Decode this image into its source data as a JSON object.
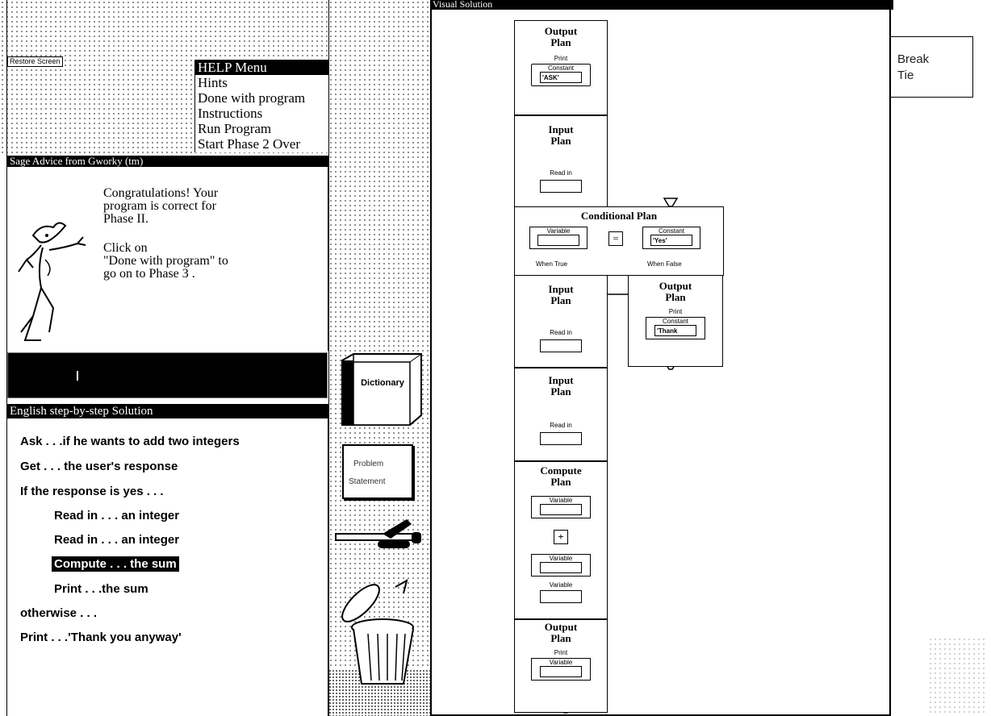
{
  "restore_screen": "Restore Screen",
  "help_menu": {
    "title": "HELP Menu",
    "items": [
      "Hints",
      "Done with program",
      "Instructions",
      "Run Program",
      "Start Phase 2 Over"
    ]
  },
  "advice": {
    "title": "Sage Advice from Gworky (tm)",
    "line1": "Congratulations! Your",
    "line2": "program is correct for",
    "line3": "Phase II.",
    "line4": "Click on",
    "line5": "\"Done with program\" to",
    "line6": "go on to Phase 3 ."
  },
  "english": {
    "title": "English step-by-step Solution",
    "steps": [
      "Ask . . .if he wants to add two integers",
      "Get . . . the user's response",
      "If the response is yes . . .",
      "Read in . . . an integer",
      "Read in . . . an integer",
      "Compute . . . the sum",
      "Print . . .the sum",
      "otherwise . . .",
      "Print . . .'Thank you anyway'"
    ]
  },
  "tools": {
    "dictionary": "Dictionary",
    "problem_line1": "Problem",
    "problem_line2": "Statement"
  },
  "visual": {
    "title": "Visual Solution",
    "output1": {
      "title1": "Output",
      "title2": "Plan",
      "label": "Print",
      "slot": "Constant",
      "value": "'ASK'"
    },
    "input1": {
      "title1": "Input",
      "title2": "Plan",
      "label": "Read in"
    },
    "conditional": {
      "title": "Conditional Plan",
      "left_slot": "Variable",
      "op": "=",
      "right_slot": "Constant",
      "right_value": "'Yes'",
      "true_label": "When True",
      "false_label": "When False"
    },
    "input2": {
      "title1": "Input",
      "title2": "Plan",
      "label": "Read in"
    },
    "output2": {
      "title1": "Output",
      "title2": "Plan",
      "label": "Print",
      "slot": "Constant",
      "value": "'Thank"
    },
    "input3": {
      "title1": "Input",
      "title2": "Plan",
      "label": "Read in"
    },
    "compute": {
      "title1": "Compute",
      "title2": "Plan",
      "slot1": "Variable",
      "op": "+",
      "slot2": "Variable",
      "result": "Variable"
    },
    "output3": {
      "title1": "Output",
      "title2": "Plan",
      "label": "Print",
      "slot": "Variable"
    }
  },
  "break_tie": {
    "line1": "Break",
    "line2": "Tie"
  }
}
